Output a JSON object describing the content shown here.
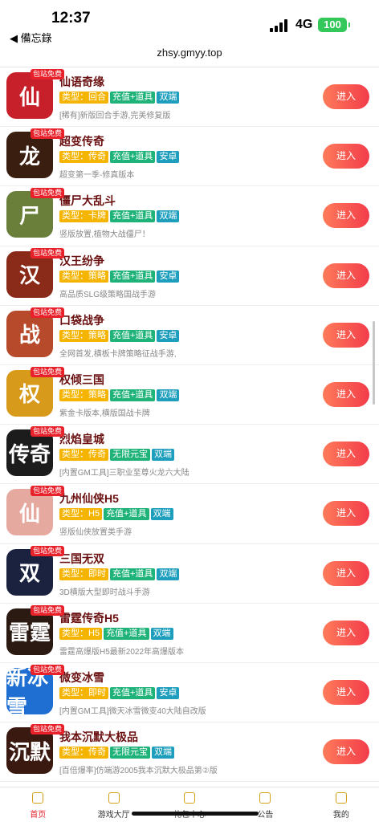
{
  "status_bar": {
    "time": "12:37",
    "back_label": "◀ 備忘錄",
    "network": "4G",
    "battery": "100"
  },
  "browser": {
    "url": "zhsy.gmyy.top"
  },
  "colors": {
    "enter_button": "#f23c4a",
    "type_tag": "#f5b400",
    "feature_tag": "#1fb37a",
    "platform_tag": "#1d9ebd",
    "ribbon": "#e8212b"
  },
  "ribbon_label": "包站免费",
  "enter_label": "进入",
  "games": [
    {
      "name": "仙语奇缘",
      "type": "类型：回合",
      "feature": "充值+道具",
      "platform": "双端",
      "desc": "[稀有]新版回合手游,完美修复版",
      "icon_char": "仙",
      "icon_bg": "#c8202a"
    },
    {
      "name": "超变传奇",
      "type": "类型：传奇",
      "feature": "充值+道具",
      "platform": "安卓",
      "desc": "超变第一季-修真版本",
      "icon_char": "龙",
      "icon_bg": "#3a1e10"
    },
    {
      "name": "僵尸大乱斗",
      "type": "类型：卡牌",
      "feature": "充值+道具",
      "platform": "双端",
      "desc": "竖版放置,植物大战僵尸！",
      "icon_char": "尸",
      "icon_bg": "#6a7f3a"
    },
    {
      "name": "汉王纷争",
      "type": "类型：策略",
      "feature": "充值+道具",
      "platform": "安卓",
      "desc": "高品质SLG级策略国战手游",
      "icon_char": "汉",
      "icon_bg": "#8a2a18"
    },
    {
      "name": "口袋战争",
      "type": "类型：策略",
      "feature": "充值+道具",
      "platform": "安卓",
      "desc": "全网首发,横板卡牌策略征战手游,",
      "icon_char": "战",
      "icon_bg": "#b64a2a"
    },
    {
      "name": "权倾三国",
      "type": "类型：策略",
      "feature": "充值+道具",
      "platform": "双端",
      "desc": "紫金卡版本,横版国战卡牌",
      "icon_char": "权",
      "icon_bg": "#d79a1a"
    },
    {
      "name": "烈焰皇城",
      "type": "类型：传奇",
      "feature": "无限元宝",
      "platform": "双端",
      "desc": "[内置GM工具]三职业至尊火龙六大陆",
      "icon_char": "传奇",
      "icon_bg": "#1c1c1c"
    },
    {
      "name": "九州仙侠H5",
      "type": "类型：H5",
      "feature": "充值+道具",
      "platform": "双端",
      "desc": "竖版仙侠放置类手游",
      "icon_char": "仙",
      "icon_bg": "#e6a9a0"
    },
    {
      "name": "三国无双",
      "type": "类型：即时",
      "feature": "充值+道具",
      "platform": "双端",
      "desc": "3D横版大型即时战斗手游",
      "icon_char": "双",
      "icon_bg": "#1b2240"
    },
    {
      "name": "雷霆传奇H5",
      "type": "类型：H5",
      "feature": "充值+道具",
      "platform": "双端",
      "desc": "雷霆高爆版H5最新2022年高爆版本",
      "icon_char": "雷霆",
      "icon_bg": "#2a1a12"
    },
    {
      "name": "微变冰雪",
      "type": "类型：即时",
      "feature": "充值+道具",
      "platform": "安卓",
      "desc": "[内置GM工具]微天冰雪微变40大陆自改版",
      "icon_char": "新冰雪",
      "icon_bg": "#1f6fd2"
    },
    {
      "name": "我本沉默大极品",
      "type": "类型：传奇",
      "feature": "无限元宝",
      "platform": "双端",
      "desc": "[百倍爆率]仿端游2005我本沉默大极品第②版",
      "icon_char": "沉默",
      "icon_bg": "#3a1a10"
    }
  ],
  "bottom_nav": [
    {
      "label": "首页",
      "icon": "home-icon"
    },
    {
      "label": "游戏大厅",
      "icon": "gamepad-icon"
    },
    {
      "label": "礼包中心",
      "icon": "gift-icon"
    },
    {
      "label": "公告",
      "icon": "chat-icon"
    },
    {
      "label": "我的",
      "icon": "user-icon"
    }
  ]
}
